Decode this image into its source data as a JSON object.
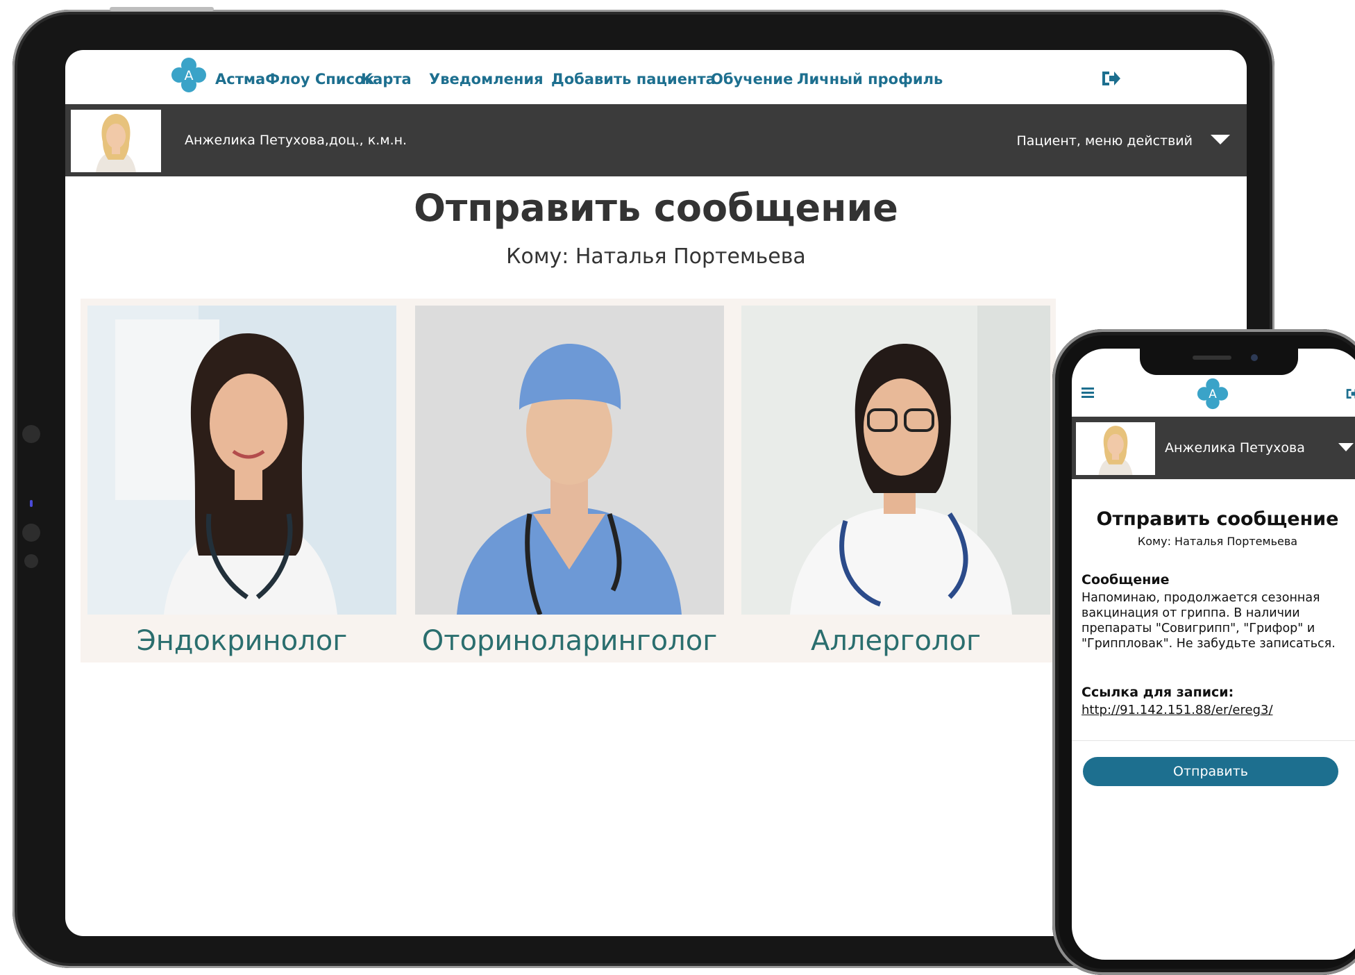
{
  "tablet": {
    "nav": {
      "brand": "АстмаФлоу Список",
      "items": [
        {
          "label": "Карта"
        },
        {
          "label": "Уведомления"
        },
        {
          "label": "Добавить пациента"
        },
        {
          "label": "Обучение"
        },
        {
          "label": "Личный профиль"
        }
      ],
      "logo_letter": "A"
    },
    "userbar": {
      "name": "Анжелика Петухова,доц., к.м.н.",
      "menu_label": "Пациент, меню действий"
    },
    "title": "Отправить сообщение",
    "recipient": "Кому: Наталья Портемьева",
    "cards": [
      {
        "label": "Эндокринолог"
      },
      {
        "label": "Оториноларинголог"
      },
      {
        "label": "Аллерголог"
      }
    ]
  },
  "phone": {
    "logo_letter": "A",
    "username": "Анжелика Петухова",
    "title": "Отправить сообщение",
    "recipient": "Кому: Наталья Портемьева",
    "message_label": "Сообщение",
    "message_text": "Напоминаю, продолжается сезонная вакцинация от гриппа. В наличии препараты \"Совигрипп\", \"Грифор\" и \"Гриппловак\". Не забудьте записаться.",
    "link_label": "Ссылка для записи:",
    "link": "http://91.142.151.88/er/ereg3/",
    "send_label": "Отправить"
  },
  "colors": {
    "brand": "#1d6f8f",
    "logo": "#3aa3c8",
    "bar": "#3b3b3b",
    "card_label": "#2a6e6e",
    "card_bg": "#f8f3ef"
  },
  "icons": [
    "logo-icon",
    "exit-icon",
    "chevron-down-icon",
    "hamburger-icon"
  ]
}
